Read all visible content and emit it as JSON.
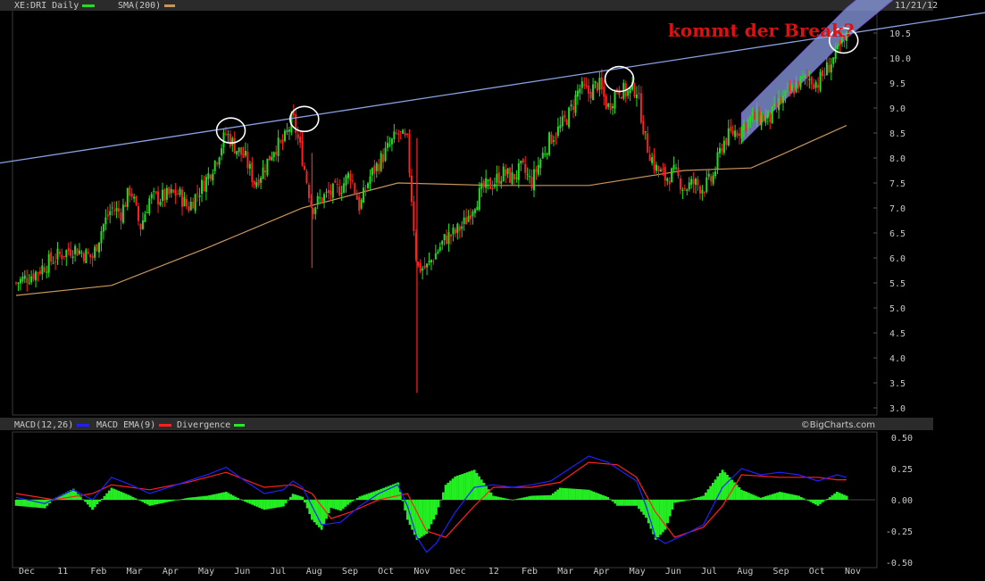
{
  "header": {
    "symbol_label": "XE:DRI Daily",
    "sma_label": "SMA(200)",
    "date": "11/21/12"
  },
  "annotation": "kommt der Break?",
  "macd_header": {
    "macd_label": "MACD(12,26)",
    "ema_label": "MACD EMA(9)",
    "div_label": "Divergence",
    "copyright": "©BigCharts.com"
  },
  "colors": {
    "bull": "#22dd22",
    "bear": "#ff2020",
    "sma": "#c8965a",
    "trendline": "#8aa0e0",
    "channel": "#8c9ee6",
    "channel_edge": "#7a5ad8",
    "macd": "#2020ff",
    "ema": "#ff2020",
    "divergence": "#22ee22",
    "annotation": "#e01010"
  },
  "chart_data": [
    {
      "type": "candlestick",
      "title": "XE:DRI Daily",
      "ylim": [
        3.0,
        10.5
      ],
      "y_ticks": [
        "3.0",
        "3.5",
        "4.0",
        "4.5",
        "5.0",
        "5.5",
        "6.0",
        "6.5",
        "7.0",
        "7.5",
        "8.0",
        "8.5",
        "9.0",
        "9.5",
        "10.0",
        "10.5"
      ],
      "x_ticks": [
        "Dec",
        "11",
        "Feb",
        "Mar",
        "Apr",
        "May",
        "Jun",
        "Jul",
        "Aug",
        "Sep",
        "Oct",
        "Nov",
        "Dec",
        "12",
        "Feb",
        "Mar",
        "Apr",
        "May",
        "Jun",
        "Jul",
        "Aug",
        "Sep",
        "Oct",
        "Nov"
      ],
      "price_path": [
        [
          0,
          5.5
        ],
        [
          2,
          5.7
        ],
        [
          4,
          6.0
        ],
        [
          6,
          6.2
        ],
        [
          8,
          6.0
        ],
        [
          9,
          6.6
        ],
        [
          10,
          7.0
        ],
        [
          11,
          6.9
        ],
        [
          12,
          7.4
        ],
        [
          13,
          6.6
        ],
        [
          14,
          7.2
        ],
        [
          15,
          7.2
        ],
        [
          17,
          7.3
        ],
        [
          18,
          7.0
        ],
        [
          20,
          7.6
        ],
        [
          21,
          8.0
        ],
        [
          22,
          8.5
        ],
        [
          23,
          8.2
        ],
        [
          24,
          8.0
        ],
        [
          25,
          7.5
        ],
        [
          26,
          7.8
        ],
        [
          27,
          8.2
        ],
        [
          28,
          8.3
        ],
        [
          29,
          8.8
        ],
        [
          30,
          8.0
        ],
        [
          31,
          7.0
        ],
        [
          32,
          7.2
        ],
        [
          33,
          7.3
        ],
        [
          34,
          7.4
        ],
        [
          35,
          7.7
        ],
        [
          36,
          7.0
        ],
        [
          37,
          7.6
        ],
        [
          38,
          7.9
        ],
        [
          39,
          8.2
        ],
        [
          40,
          8.5
        ],
        [
          41,
          8.3
        ],
        [
          42,
          5.8
        ],
        [
          43,
          5.8
        ],
        [
          44,
          6.1
        ],
        [
          45,
          6.4
        ],
        [
          46,
          6.5
        ],
        [
          47,
          6.7
        ],
        [
          48,
          7.1
        ],
        [
          49,
          7.4
        ],
        [
          50,
          7.5
        ],
        [
          51,
          7.7
        ],
        [
          52,
          7.6
        ],
        [
          53,
          7.8
        ],
        [
          54,
          7.5
        ],
        [
          55,
          8.0
        ],
        [
          56,
          8.4
        ],
        [
          57,
          8.6
        ],
        [
          58,
          8.9
        ],
        [
          59,
          9.4
        ],
        [
          60,
          9.3
        ],
        [
          61,
          9.5
        ],
        [
          62,
          9.0
        ],
        [
          63,
          9.4
        ],
        [
          64,
          9.3
        ],
        [
          65,
          9.4
        ],
        [
          66,
          8.3
        ],
        [
          67,
          7.8
        ],
        [
          68,
          7.6
        ],
        [
          69,
          7.7
        ],
        [
          70,
          7.4
        ],
        [
          71,
          7.5
        ],
        [
          72,
          7.4
        ],
        [
          73,
          7.6
        ],
        [
          74,
          8.3
        ],
        [
          75,
          8.5
        ],
        [
          76,
          8.6
        ],
        [
          77,
          8.8
        ],
        [
          78,
          8.8
        ],
        [
          79,
          8.8
        ],
        [
          80,
          9.1
        ],
        [
          81,
          9.3
        ],
        [
          82,
          9.5
        ],
        [
          83,
          9.6
        ],
        [
          84,
          9.5
        ],
        [
          85,
          9.8
        ],
        [
          86,
          10.1
        ],
        [
          87,
          10.4
        ]
      ],
      "spikes": [
        {
          "x": 42,
          "low": 3.3,
          "high": 8.4
        },
        {
          "x": 31,
          "low": 5.8,
          "high": 8.1
        }
      ],
      "sma200": [
        [
          0,
          5.25
        ],
        [
          10,
          5.45
        ],
        [
          20,
          6.2
        ],
        [
          30,
          7.0
        ],
        [
          40,
          7.5
        ],
        [
          50,
          7.45
        ],
        [
          60,
          7.45
        ],
        [
          70,
          7.75
        ],
        [
          77,
          7.8
        ],
        [
          80,
          8.05
        ],
        [
          87,
          8.65
        ]
      ],
      "trendline": {
        "from": [
          -2,
          7.9
        ],
        "to": [
          96,
          10.8
        ]
      },
      "channel": {
        "lower": [
          [
            76,
            8.3
          ],
          [
            87,
            10.4
          ],
          [
            94,
            11.5
          ]
        ],
        "upper": [
          [
            76,
            8.9
          ],
          [
            87,
            11.0
          ],
          [
            94,
            12.1
          ]
        ]
      },
      "circles": [
        [
          22.5,
          8.55
        ],
        [
          30.2,
          8.78
        ],
        [
          63.2,
          9.58
        ],
        [
          86.7,
          10.35
        ]
      ]
    },
    {
      "type": "line",
      "title": "MACD(12,26)",
      "ylim": [
        -0.5,
        0.5
      ],
      "y_ticks": [
        "0.50",
        "0.25",
        "0.00",
        "-0.25",
        "-0.50"
      ],
      "series": [
        {
          "name": "MACD(12,26)",
          "values": [
            [
              0,
              0.02
            ],
            [
              3,
              -0.03
            ],
            [
              6,
              0.08
            ],
            [
              8,
              0.0
            ],
            [
              10,
              0.18
            ],
            [
              12,
              0.12
            ],
            [
              14,
              0.05
            ],
            [
              16,
              0.1
            ],
            [
              18,
              0.15
            ],
            [
              20,
              0.2
            ],
            [
              22,
              0.26
            ],
            [
              24,
              0.15
            ],
            [
              26,
              0.05
            ],
            [
              28,
              0.08
            ],
            [
              29,
              0.15
            ],
            [
              30,
              0.1
            ],
            [
              32,
              -0.2
            ],
            [
              34,
              -0.18
            ],
            [
              36,
              -0.05
            ],
            [
              38,
              0.05
            ],
            [
              40,
              0.12
            ],
            [
              41,
              -0.05
            ],
            [
              42,
              -0.3
            ],
            [
              43,
              -0.42
            ],
            [
              44,
              -0.35
            ],
            [
              46,
              -0.1
            ],
            [
              48,
              0.1
            ],
            [
              50,
              0.12
            ],
            [
              52,
              0.1
            ],
            [
              54,
              0.12
            ],
            [
              56,
              0.15
            ],
            [
              58,
              0.25
            ],
            [
              60,
              0.35
            ],
            [
              62,
              0.3
            ],
            [
              64,
              0.2
            ],
            [
              65,
              0.15
            ],
            [
              66,
              -0.05
            ],
            [
              67,
              -0.3
            ],
            [
              68,
              -0.35
            ],
            [
              70,
              -0.28
            ],
            [
              72,
              -0.2
            ],
            [
              74,
              0.1
            ],
            [
              76,
              0.25
            ],
            [
              78,
              0.2
            ],
            [
              80,
              0.22
            ],
            [
              82,
              0.2
            ],
            [
              84,
              0.15
            ],
            [
              86,
              0.2
            ],
            [
              87,
              0.18
            ]
          ]
        },
        {
          "name": "MACD EMA(9)",
          "values": [
            [
              0,
              0.05
            ],
            [
              4,
              0.0
            ],
            [
              8,
              0.05
            ],
            [
              10,
              0.12
            ],
            [
              14,
              0.08
            ],
            [
              18,
              0.14
            ],
            [
              22,
              0.22
            ],
            [
              26,
              0.1
            ],
            [
              29,
              0.12
            ],
            [
              31,
              0.05
            ],
            [
              33,
              -0.15
            ],
            [
              35,
              -0.1
            ],
            [
              38,
              0.0
            ],
            [
              41,
              0.05
            ],
            [
              43,
              -0.25
            ],
            [
              45,
              -0.3
            ],
            [
              48,
              -0.05
            ],
            [
              50,
              0.1
            ],
            [
              54,
              0.1
            ],
            [
              57,
              0.14
            ],
            [
              60,
              0.3
            ],
            [
              63,
              0.28
            ],
            [
              65,
              0.18
            ],
            [
              67,
              -0.1
            ],
            [
              69,
              -0.3
            ],
            [
              72,
              -0.22
            ],
            [
              74,
              -0.05
            ],
            [
              76,
              0.2
            ],
            [
              80,
              0.18
            ],
            [
              84,
              0.18
            ],
            [
              86,
              0.16
            ],
            [
              87,
              0.16
            ]
          ]
        },
        {
          "name": "Divergence"
        }
      ]
    }
  ]
}
